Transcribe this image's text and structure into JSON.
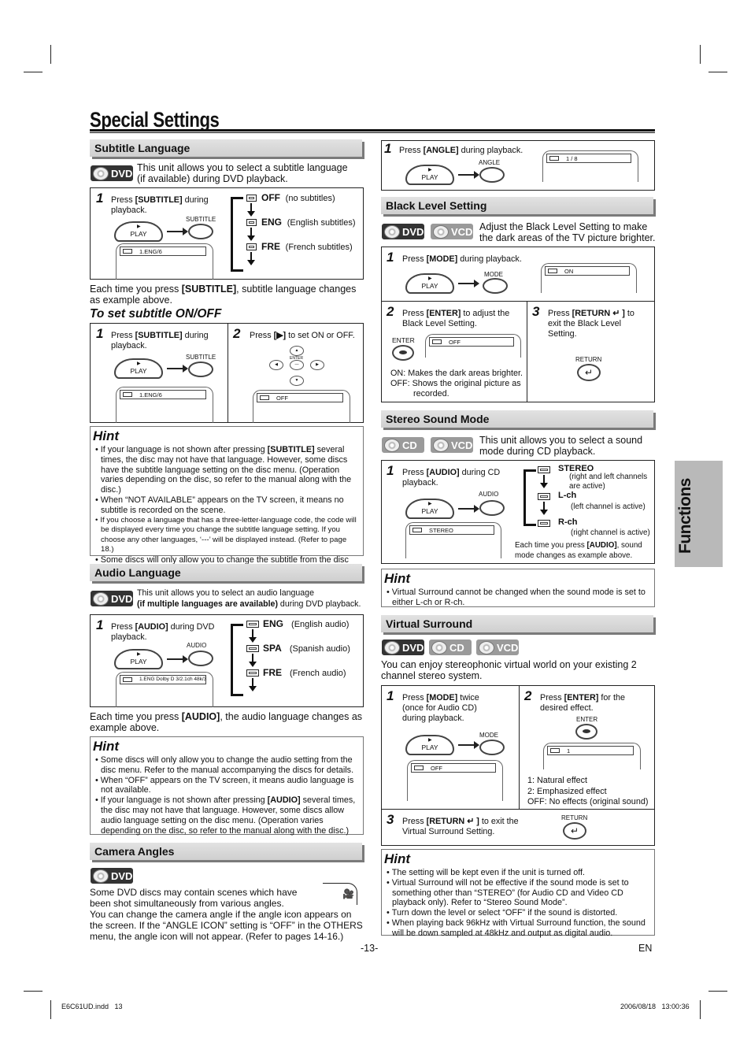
{
  "page": {
    "title": "Special Settings",
    "side_tab": "Functions",
    "page_number": "-13-",
    "lang_code": "EN",
    "footer_file": "E6C61UD.indd   13",
    "footer_timestamp": "2006/08/18   13:00:36"
  },
  "badges": {
    "dvd": "DVD",
    "vcd": "VCD",
    "cd": "CD"
  },
  "subtitle_language": {
    "heading": "Subtitle Language",
    "intro_1": "This unit allows you to select a subtitle language",
    "intro_2": "(if available) during DVD playback.",
    "step1_num": "1",
    "step1_pre": "Press ",
    "step1_key": "[SUBTITLE]",
    "step1_post": " during playback.",
    "play_label": "PLAY",
    "button_label": "SUBTITLE",
    "screen_text": "1.ENG/6",
    "options": [
      {
        "code": "OFF",
        "desc": "(no subtitles)"
      },
      {
        "code": "ENG",
        "desc": "(English subtitles)"
      },
      {
        "code": "FRE",
        "desc": "(French subtitles)"
      }
    ],
    "after_pre": "Each time you press ",
    "after_key": "[SUBTITLE]",
    "after_post": ", subtitle language changes as example above."
  },
  "subtitle_on_off": {
    "heading": "To set subtitle ON/OFF",
    "step1_num": "1",
    "step1_pre": "Press ",
    "step1_key": "[SUBTITLE]",
    "step1_post": " during playback.",
    "play_label": "PLAY",
    "button_label": "SUBTITLE",
    "screen_text_1": "1.ENG/6",
    "step2_num": "2",
    "step2_pre": "Press ",
    "step2_key": "[▶]",
    "step2_post": " to set ON or OFF.",
    "enter_label": "ENTER",
    "screen_text_2": "OFF"
  },
  "subtitle_hint": {
    "title": "Hint",
    "items": [
      "If your language is not shown after pressing [SUBTITLE] several times, the disc may not have that language. However, some discs have the subtitle language setting on the disc menu. (Operation varies depending on the disc, so refer to the manual along with the disc.)",
      "When “NOT AVAILABLE” appears on the TV screen, it means no subtitle is recorded on the scene.",
      "If you choose a language that has a three-letter-language code, the code will be displayed every time you change the subtitle language setting. If you choose any other languages, ‘---’ will be displayed instead. (Refer to page 18.)",
      "Some discs will only allow you to change the subtitle from the disc menu. Refer to the manual accompanying the discs for details."
    ]
  },
  "audio_language": {
    "heading": "Audio Language",
    "intro_1": "This unit allows you to select an audio language",
    "intro_2_bold": "(if multiple languages are available)",
    "intro_2_rest": " during DVD playback.",
    "step1_num": "1",
    "step1_pre": "Press ",
    "step1_key": "[AUDIO]",
    "step1_post": " during DVD playback.",
    "play_label": "PLAY",
    "button_label": "AUDIO",
    "screen_text": "1.ENG  Dolby D  3/2.1ch  48k/3",
    "options": [
      {
        "code": "ENG",
        "desc": "(English audio)"
      },
      {
        "code": "SPA",
        "desc": "(Spanish audio)"
      },
      {
        "code": "FRE",
        "desc": "(French audio)"
      }
    ],
    "after_pre": "Each time you press ",
    "after_key": "[AUDIO]",
    "after_post": ", the audio language changes as example above."
  },
  "audio_hint": {
    "title": "Hint",
    "items": [
      "Some discs will only allow you to change the audio setting from the disc menu. Refer to the manual accompanying the discs for details.",
      "When “OFF” appears on the TV screen, it means audio language is not available.",
      "If your language is not shown after pressing [AUDIO] several times, the disc may not have that language. However, some discs allow audio language setting on the disc menu. (Operation varies depending on the disc, so refer to the manual along with the disc.)"
    ]
  },
  "camera_angles": {
    "heading": "Camera Angles",
    "para_1": "Some DVD discs may contain scenes which have been shot simultaneously from various angles.",
    "para_2": "You can change the camera angle if the angle icon appears on the screen. If the “ANGLE ICON” setting is “OFF” in the OTHERS menu, the angle icon will not appear. (Refer to pages 14-16.)",
    "step1_num": "1",
    "step1_pre": "Press ",
    "step1_key": "[ANGLE]",
    "step1_post": " during playback.",
    "play_label": "PLAY",
    "button_label": "ANGLE",
    "screen_text": "1 / 8"
  },
  "black_level": {
    "heading": "Black Level Setting",
    "intro": "Adjust the Black Level Setting to make the dark areas of the TV picture brighter.",
    "step1_num": "1",
    "step1_pre": "Press ",
    "step1_key": "[MODE]",
    "step1_post": " during playback.",
    "play_label": "PLAY",
    "button_label": "MODE",
    "screen_text_1": "ON",
    "step2_num": "2",
    "step2_pre": "Press ",
    "step2_key": "[ENTER]",
    "step2_post": " to adjust the Black Level Setting.",
    "enter_label": "ENTER",
    "screen_text_2": "OFF",
    "note_on": "ON: Makes the dark areas brighter.",
    "note_off": "OFF: Shows the original picture as recorded.",
    "step3_num": "3",
    "step3_pre": "Press ",
    "step3_key": "[RETURN ↵ ]",
    "step3_post": " to exit the Black Level Setting.",
    "return_label": "RETURN"
  },
  "stereo_sound": {
    "heading": "Stereo Sound Mode",
    "intro": "This unit allows you to select a sound mode during CD playback.",
    "step1_num": "1",
    "step1_pre": "Press ",
    "step1_key": "[AUDIO]",
    "step1_post": " during CD playback.",
    "play_label": "PLAY",
    "button_label": "AUDIO",
    "screen_text": "STEREO",
    "options": [
      {
        "code": "STEREO",
        "desc": "(right and left channels are active)"
      },
      {
        "code": "L-ch",
        "desc": "(left channel is active)"
      },
      {
        "code": "R-ch",
        "desc": "(right channel is active)"
      }
    ],
    "after_pre": "Each time you press ",
    "after_key": "[AUDIO]",
    "after_post": ", sound mode changes as example above."
  },
  "stereo_hint": {
    "title": "Hint",
    "items": [
      "Virtual Surround cannot be changed when the sound mode is set to either L-ch or R-ch."
    ]
  },
  "virtual_surround": {
    "heading": "Virtual Surround",
    "intro": "You can enjoy stereophonic virtual world on your existing 2 channel stereo system.",
    "step1_num": "1",
    "step1_pre": "Press ",
    "step1_key": "[MODE]",
    "step1_post": " twice (once for Audio CD) during  playback.",
    "play_label": "PLAY",
    "button_label": "MODE",
    "screen_text_1": "OFF",
    "step2_num": "2",
    "step2_pre": "Press ",
    "step2_key": "[ENTER]",
    "step2_post": " for the desired effect.",
    "enter_label": "ENTER",
    "screen_text_2": "1",
    "effects": [
      "1: Natural effect",
      "2: Emphasized effect",
      "OFF: No effects (original sound)"
    ],
    "step3_num": "3",
    "step3_pre": "Press ",
    "step3_key": "[RETURN ↵ ]",
    "step3_post": " to exit the Virtual Surround Setting.",
    "return_label": "RETURN"
  },
  "surround_hint": {
    "title": "Hint",
    "items": [
      "The setting will be kept even if the unit is turned off.",
      "Virtual Surround will not be effective if the sound mode is set to something other than “STEREO” (for Audio CD and Video CD playback only). Refer to “Stereo Sound Mode”.",
      "Turn down the level or select “OFF” if the sound is distorted.",
      "When playing back 96kHz with Virtual Surround function, the sound will be down sampled at 48kHz and output as digital audio."
    ]
  }
}
